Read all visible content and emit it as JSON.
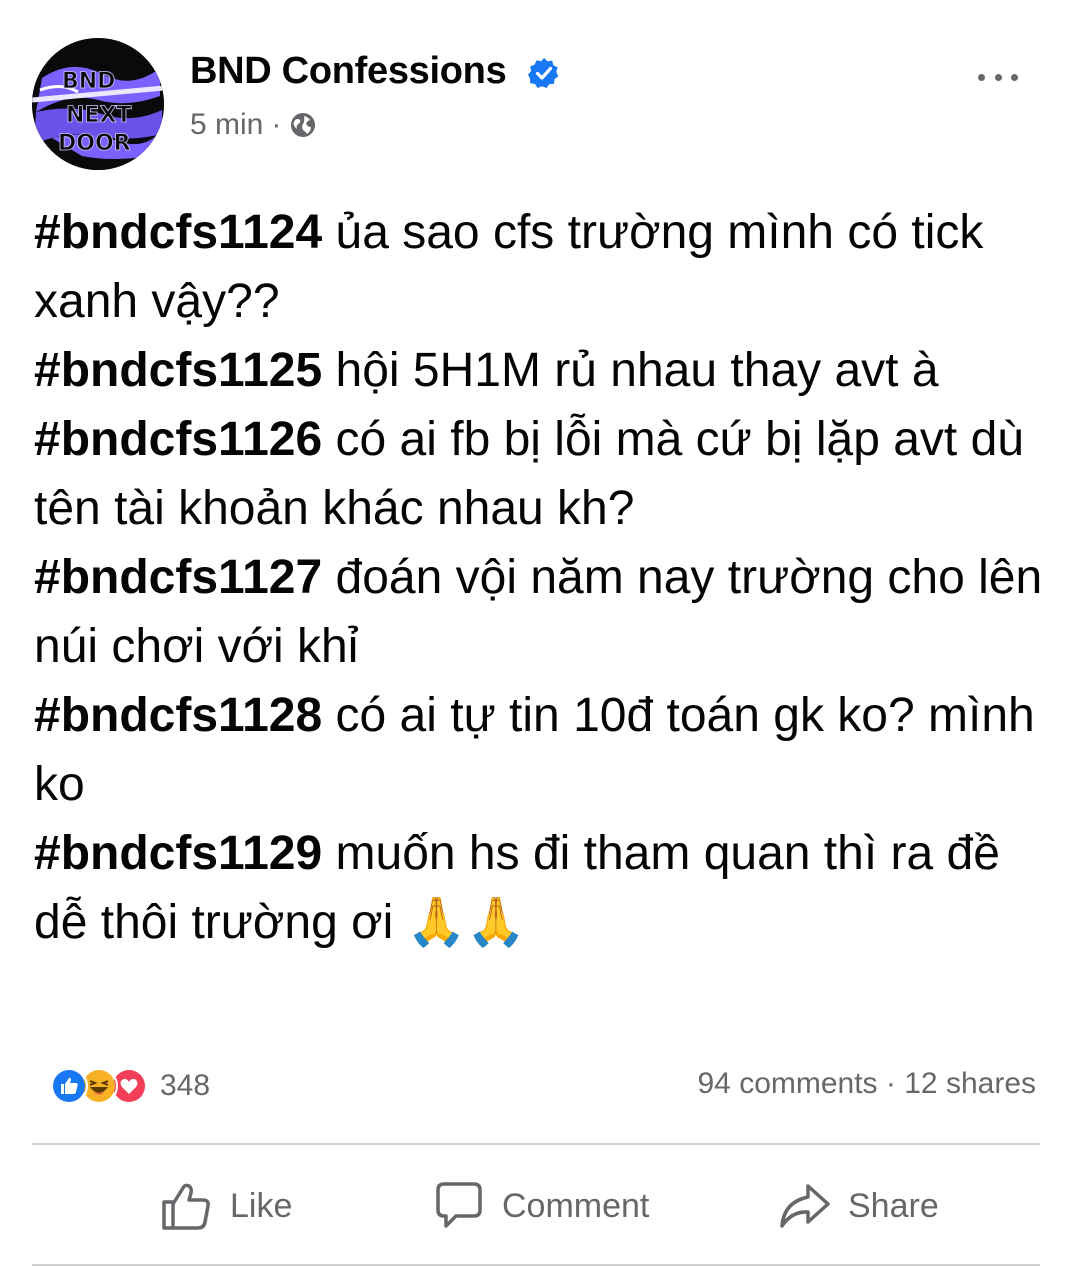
{
  "header": {
    "page_name": "BND Confessions",
    "time": "5 min",
    "separator": "·",
    "verified_icon": "verified-badge-icon",
    "privacy_icon": "globe-icon",
    "more_icon": "more-options-icon",
    "avatar_text": "BND NEXT DOOR"
  },
  "post": {
    "lines": [
      {
        "tag": "#bndcfs1124",
        "text": " ủa sao cfs trường mình có tick xanh vậy??"
      },
      {
        "tag": "#bndcfs1125",
        "text": " hội 5H1M rủ nhau thay avt à"
      },
      {
        "tag": "#bndcfs1126",
        "text": " có ai fb bị lỗi mà cứ bị lặp avt dù tên tài khoản khác nhau kh?"
      },
      {
        "tag": "#bndcfs1127",
        "text": " đoán vội năm nay trường cho lên núi chơi với khỉ"
      },
      {
        "tag": "#bndcfs1128",
        "text": "  có ai tự tin 10đ toán gk ko? mình ko"
      },
      {
        "tag": "#bndcfs1129",
        "text": " muốn hs đi tham quan thì ra đề dễ thôi trường ơi 🙏🙏"
      }
    ]
  },
  "stats": {
    "reaction_icons": [
      "like-reaction-icon",
      "haha-reaction-icon",
      "love-reaction-icon"
    ],
    "reaction_count": "348",
    "comments": "94 comments",
    "separator": "·",
    "shares": "12 shares"
  },
  "actions": {
    "like_label": "Like",
    "comment_label": "Comment",
    "share_label": "Share"
  },
  "colors": {
    "accent": "#1877f2",
    "secondary_text": "#65676b",
    "love": "#f33e58",
    "haha": "#f7b125",
    "avatar_purple": "#7b61ff"
  }
}
